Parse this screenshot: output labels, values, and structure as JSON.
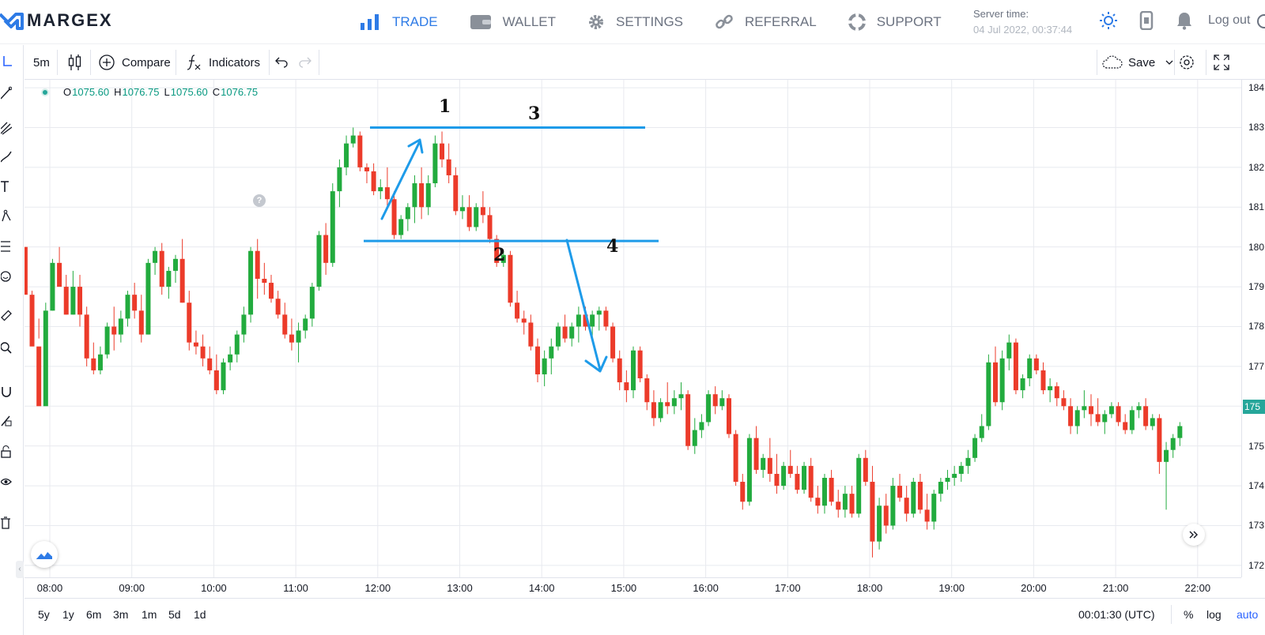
{
  "brand": {
    "name": "MARGEX",
    "accent": "#2e7be6"
  },
  "nav": [
    {
      "label": "TRADE",
      "icon": "bar-chart-icon",
      "active": true
    },
    {
      "label": "WALLET",
      "icon": "wallet-icon",
      "active": false
    },
    {
      "label": "SETTINGS",
      "icon": "gear-icon",
      "active": false
    },
    {
      "label": "REFERRAL",
      "icon": "link-icon",
      "active": false
    },
    {
      "label": "SUPPORT",
      "icon": "lifebuoy-icon",
      "active": false
    }
  ],
  "server": {
    "label": "Server time:",
    "value": "04 Jul 2022, 00:37:44"
  },
  "header_icons": [
    "sun-icon",
    "mobile-icon",
    "bell-icon"
  ],
  "logout_label": "Log out",
  "toolbar": {
    "interval": "5m",
    "compare_label": "Compare",
    "indicators_label": "Indicators",
    "save_label": "Save"
  },
  "ohlc": {
    "o": "1075.60",
    "h": "1076.75",
    "l": "1075.60",
    "c": "1076.75"
  },
  "price_labels": [
    "184",
    "183",
    "182",
    "181",
    "180",
    "179",
    "178",
    "177",
    "176",
    "175",
    "174",
    "173",
    "172"
  ],
  "current_price": "175",
  "time_labels": [
    "08:00",
    "09:00",
    "10:00",
    "11:00",
    "12:00",
    "13:00",
    "14:00",
    "15:00",
    "16:00",
    "17:00",
    "18:00",
    "19:00",
    "20:00",
    "21:00",
    "22:00"
  ],
  "annotations": [
    "1",
    "2",
    "3",
    "4"
  ],
  "ranges": [
    "5y",
    "1y",
    "6m",
    "3m",
    "1m",
    "5d",
    "1d"
  ],
  "clock": "00:01:30 (UTC)",
  "scale_options": {
    "percent": "%",
    "log": "log",
    "auto": "auto"
  },
  "colors": {
    "up": "#22ab3e",
    "down": "#ec3b2a",
    "drawing": "#1e9be9",
    "grid": "#e8eaef"
  },
  "chart_data": {
    "type": "candlestick",
    "interval": "5m",
    "candles": [
      [
        180,
        179.4,
        179.5,
        178.8
      ],
      [
        178.8,
        178.9,
        178.8,
        177.5
      ],
      [
        177.5,
        178.2,
        177.7,
        176.0
      ],
      [
        176.0,
        178.6,
        176.1,
        178.4
      ],
      [
        178.4,
        179.7,
        178.4,
        179.6
      ],
      [
        179.6,
        180.0,
        179.6,
        179.0
      ],
      [
        179.0,
        179.3,
        178.3,
        178.3
      ],
      [
        178.3,
        179.4,
        178.3,
        179.0
      ],
      [
        179.0,
        179.3,
        178.0,
        178.3
      ],
      [
        178.3,
        178.5,
        177.0,
        177.2
      ],
      [
        177.2,
        177.6,
        176.8,
        176.9
      ],
      [
        176.9,
        177.5,
        176.8,
        177.3
      ],
      [
        177.3,
        178.1,
        177.2,
        178.0
      ],
      [
        178.0,
        178.5,
        177.4,
        177.8
      ],
      [
        177.8,
        178.4,
        177.6,
        178.2
      ],
      [
        178.2,
        178.9,
        178.0,
        178.8
      ],
      [
        178.8,
        179.1,
        178.2,
        178.4
      ],
      [
        178.4,
        178.8,
        177.6,
        177.8
      ],
      [
        177.8,
        179.7,
        177.8,
        179.6
      ],
      [
        179.6,
        180.0,
        179.3,
        179.9
      ],
      [
        179.9,
        180.1,
        178.8,
        179.0
      ],
      [
        179.0,
        179.5,
        178.7,
        179.4
      ],
      [
        179.4,
        179.8,
        179.1,
        179.7
      ],
      [
        179.7,
        180.2,
        178.6,
        178.6
      ],
      [
        178.6,
        178.9,
        177.4,
        177.6
      ],
      [
        177.6,
        177.9,
        177.3,
        177.5
      ],
      [
        177.5,
        177.8,
        177.0,
        177.2
      ],
      [
        177.2,
        177.5,
        176.8,
        176.9
      ],
      [
        176.9,
        177.3,
        176.3,
        176.4
      ],
      [
        176.4,
        177.2,
        176.3,
        177.1
      ],
      [
        177.1,
        177.5,
        176.9,
        177.3
      ],
      [
        177.3,
        177.9,
        177.1,
        177.8
      ],
      [
        177.8,
        178.5,
        177.6,
        178.3
      ],
      [
        178.3,
        180.0,
        178.1,
        179.9
      ],
      [
        179.9,
        180.2,
        178.7,
        179.2
      ],
      [
        179.2,
        179.6,
        178.8,
        179.1
      ],
      [
        179.1,
        179.3,
        178.6,
        178.7
      ],
      [
        178.7,
        178.9,
        178.2,
        178.3
      ],
      [
        178.3,
        178.6,
        177.7,
        177.8
      ],
      [
        177.8,
        178.2,
        177.4,
        177.6
      ],
      [
        177.6,
        178.1,
        177.1,
        177.9
      ],
      [
        177.9,
        178.3,
        177.7,
        178.2
      ],
      [
        178.2,
        179.1,
        178.0,
        179.0
      ],
      [
        179.0,
        180.4,
        178.9,
        180.3
      ],
      [
        180.3,
        180.6,
        179.3,
        179.6
      ],
      [
        179.6,
        181.6,
        179.5,
        181.4
      ],
      [
        181.4,
        182.2,
        181.0,
        182.0
      ],
      [
        182.0,
        182.8,
        181.8,
        182.6
      ],
      [
        182.6,
        183.0,
        182.5,
        182.8
      ],
      [
        182.8,
        182.9,
        181.9,
        182.0
      ],
      [
        182.0,
        182.1,
        181.6,
        181.9
      ],
      [
        181.9,
        182.1,
        181.3,
        181.4
      ],
      [
        181.4,
        181.7,
        181.2,
        181.5
      ],
      [
        181.5,
        182.0,
        181.0,
        181.2
      ],
      [
        181.2,
        181.4,
        180.2,
        180.3
      ],
      [
        180.3,
        180.8,
        180.2,
        180.7
      ],
      [
        180.7,
        181.1,
        180.4,
        181.0
      ],
      [
        181.0,
        181.8,
        180.6,
        181.6
      ],
      [
        181.6,
        182.0,
        180.7,
        181.0
      ],
      [
        181.0,
        181.8,
        180.8,
        181.6
      ],
      [
        181.6,
        182.8,
        181.5,
        182.6
      ],
      [
        182.6,
        182.9,
        182.0,
        182.2
      ],
      [
        182.2,
        182.6,
        181.6,
        181.8
      ],
      [
        181.8,
        182.0,
        180.8,
        180.9
      ],
      [
        180.9,
        181.3,
        180.7,
        181.0
      ],
      [
        181.0,
        181.3,
        180.4,
        180.5
      ],
      [
        180.5,
        181.1,
        180.4,
        181.0
      ],
      [
        181.0,
        181.4,
        180.6,
        180.8
      ],
      [
        180.8,
        181.0,
        180.1,
        180.2
      ],
      [
        180.2,
        180.3,
        179.5,
        179.6
      ],
      [
        179.6,
        179.9,
        179.5,
        179.8
      ],
      [
        179.8,
        179.9,
        178.5,
        178.6
      ],
      [
        178.6,
        178.9,
        178.1,
        178.2
      ],
      [
        178.2,
        178.4,
        177.8,
        178.1
      ],
      [
        178.1,
        178.3,
        177.4,
        177.5
      ],
      [
        177.5,
        177.7,
        176.6,
        176.8
      ],
      [
        176.8,
        177.4,
        176.5,
        177.2
      ],
      [
        177.2,
        177.7,
        176.8,
        177.5
      ],
      [
        177.5,
        178.1,
        177.4,
        178.0
      ],
      [
        178.0,
        178.3,
        177.6,
        177.7
      ],
      [
        177.7,
        178.1,
        177.5,
        178.0
      ],
      [
        178.0,
        178.5,
        177.6,
        178.3
      ],
      [
        178.3,
        178.5,
        177.9,
        178.0
      ],
      [
        178.0,
        178.4,
        177.7,
        178.3
      ],
      [
        178.3,
        178.5,
        177.9,
        178.4
      ],
      [
        178.4,
        178.5,
        177.9,
        178.0
      ],
      [
        178.0,
        178.1,
        177.1,
        177.2
      ],
      [
        177.2,
        177.4,
        176.4,
        176.6
      ],
      [
        176.6,
        176.9,
        176.1,
        176.4
      ],
      [
        176.4,
        177.5,
        176.2,
        177.4
      ],
      [
        177.4,
        177.5,
        176.6,
        176.7
      ],
      [
        176.7,
        176.8,
        175.9,
        176.1
      ],
      [
        176.1,
        176.4,
        175.5,
        175.7
      ],
      [
        175.7,
        176.2,
        175.6,
        176.1
      ],
      [
        176.1,
        176.6,
        175.8,
        176.0
      ],
      [
        176.0,
        176.4,
        175.8,
        176.2
      ],
      [
        176.2,
        176.6,
        175.9,
        176.3
      ],
      [
        176.3,
        176.4,
        174.9,
        175.0
      ],
      [
        175.0,
        175.7,
        174.8,
        175.4
      ],
      [
        175.4,
        175.8,
        175.2,
        175.6
      ],
      [
        175.6,
        176.4,
        175.5,
        176.3
      ],
      [
        176.3,
        176.5,
        175.8,
        176.0
      ],
      [
        176.0,
        176.4,
        175.9,
        176.2
      ],
      [
        176.2,
        176.3,
        175.2,
        175.3
      ],
      [
        175.3,
        175.4,
        174.0,
        174.1
      ],
      [
        174.1,
        174.3,
        173.4,
        173.6
      ],
      [
        173.6,
        175.3,
        173.5,
        175.2
      ],
      [
        175.2,
        175.5,
        174.3,
        174.4
      ],
      [
        174.4,
        174.8,
        174.2,
        174.7
      ],
      [
        174.7,
        175.2,
        174.1,
        174.3
      ],
      [
        174.3,
        174.8,
        173.8,
        174.0
      ],
      [
        174.0,
        174.6,
        173.9,
        174.5
      ],
      [
        174.5,
        174.9,
        174.2,
        174.3
      ],
      [
        174.3,
        174.5,
        173.8,
        173.9
      ],
      [
        173.9,
        174.6,
        173.8,
        174.5
      ],
      [
        174.5,
        174.7,
        173.6,
        173.7
      ],
      [
        173.7,
        174.0,
        173.3,
        173.5
      ],
      [
        173.5,
        174.3,
        173.3,
        174.2
      ],
      [
        174.2,
        174.4,
        173.5,
        173.6
      ],
      [
        173.6,
        173.9,
        173.2,
        173.4
      ],
      [
        173.4,
        174.0,
        173.2,
        173.8
      ],
      [
        173.8,
        174.0,
        173.2,
        173.3
      ],
      [
        173.3,
        174.8,
        173.2,
        174.7
      ],
      [
        174.7,
        174.9,
        174.0,
        174.1
      ],
      [
        174.1,
        174.5,
        172.2,
        172.6
      ],
      [
        172.6,
        173.7,
        172.4,
        173.5
      ],
      [
        173.5,
        173.8,
        172.8,
        173.0
      ],
      [
        173.0,
        174.2,
        172.9,
        174.0
      ],
      [
        174.0,
        174.3,
        173.6,
        173.7
      ],
      [
        173.7,
        174.0,
        173.1,
        173.3
      ],
      [
        173.3,
        174.2,
        173.2,
        174.1
      ],
      [
        174.1,
        174.3,
        173.3,
        173.4
      ],
      [
        173.4,
        173.8,
        172.9,
        173.1
      ],
      [
        173.1,
        173.9,
        172.9,
        173.8
      ],
      [
        173.8,
        174.2,
        173.6,
        174.1
      ],
      [
        174.1,
        174.4,
        173.9,
        174.2
      ],
      [
        174.2,
        174.5,
        174.0,
        174.3
      ],
      [
        174.3,
        174.6,
        174.1,
        174.5
      ],
      [
        174.5,
        174.9,
        174.3,
        174.7
      ],
      [
        174.7,
        175.3,
        174.6,
        175.2
      ],
      [
        175.2,
        175.8,
        175.1,
        175.5
      ],
      [
        175.5,
        177.3,
        175.4,
        177.1
      ],
      [
        177.1,
        177.5,
        176.0,
        176.1
      ],
      [
        176.1,
        177.4,
        175.9,
        177.2
      ],
      [
        177.2,
        177.8,
        176.9,
        177.6
      ],
      [
        177.6,
        177.7,
        176.3,
        176.4
      ],
      [
        176.4,
        176.8,
        176.2,
        176.7
      ],
      [
        176.7,
        177.3,
        176.5,
        177.2
      ],
      [
        177.2,
        177.3,
        176.8,
        176.9
      ],
      [
        176.9,
        177.1,
        176.3,
        176.4
      ],
      [
        176.4,
        176.7,
        176.1,
        176.5
      ],
      [
        176.5,
        176.6,
        176.0,
        176.2
      ],
      [
        176.2,
        176.4,
        175.9,
        176.0
      ],
      [
        176.0,
        176.2,
        175.3,
        175.5
      ],
      [
        175.5,
        176.0,
        175.3,
        175.9
      ],
      [
        175.9,
        176.4,
        175.7,
        176.0
      ],
      [
        176.0,
        176.3,
        175.5,
        175.8
      ],
      [
        175.8,
        176.2,
        175.5,
        175.6
      ],
      [
        175.6,
        175.9,
        175.3,
        175.8
      ],
      [
        175.8,
        176.1,
        175.7,
        176.0
      ],
      [
        176.0,
        176.1,
        175.5,
        175.6
      ],
      [
        175.6,
        175.8,
        175.3,
        175.4
      ],
      [
        175.4,
        176.0,
        175.3,
        175.9
      ],
      [
        175.9,
        176.1,
        175.7,
        176.0
      ],
      [
        176.0,
        176.2,
        175.4,
        175.5
      ],
      [
        175.5,
        175.8,
        175.4,
        175.7
      ],
      [
        175.7,
        175.8,
        174.3,
        174.6
      ],
      [
        174.6,
        175.1,
        173.4,
        174.9
      ],
      [
        174.9,
        175.3,
        174.7,
        175.2
      ],
      [
        175.2,
        175.6,
        175.0,
        175.5
      ]
    ],
    "horizontal_lines": [
      183.0,
      180.15
    ],
    "xlim": [
      "08:00",
      "22:00"
    ],
    "ylim": [
      171.7,
      184.2
    ],
    "grid": true
  }
}
